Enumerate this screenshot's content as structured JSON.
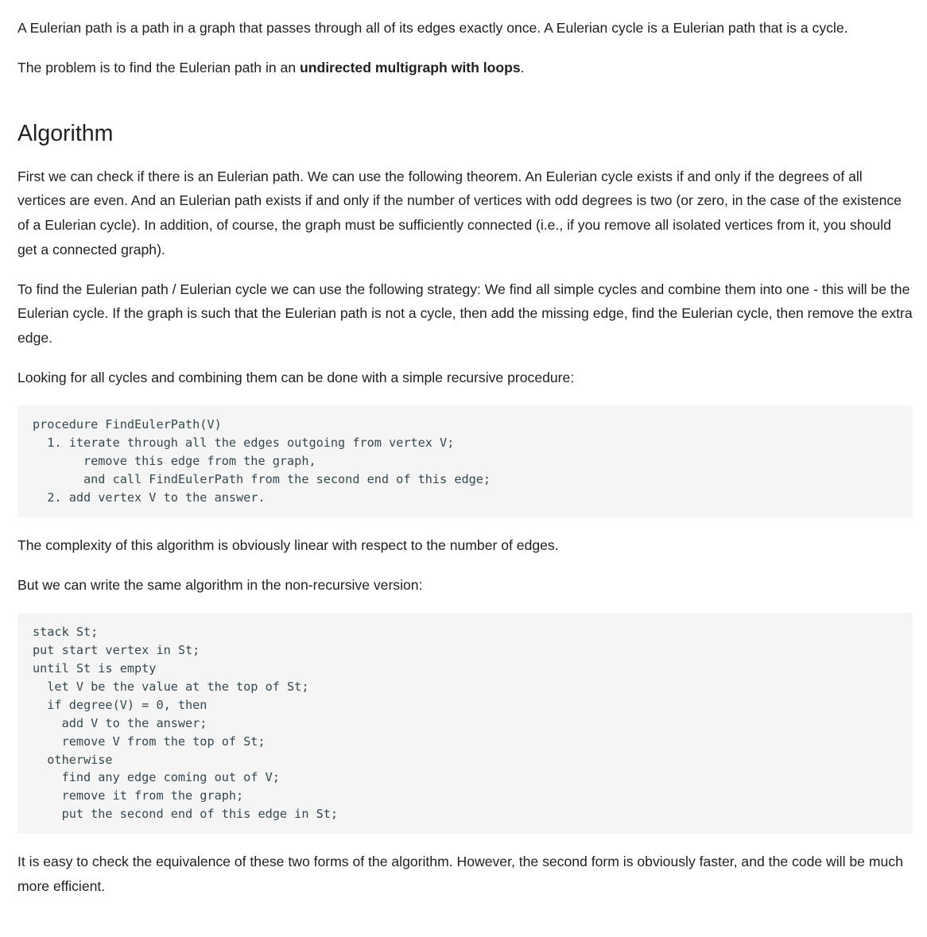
{
  "intro": {
    "p1": "A Eulerian path is a path in a graph that passes through all of its edges exactly once. A Eulerian cycle is a Eulerian path that is a cycle.",
    "p2_before": "The problem is to find the Eulerian path in an ",
    "p2_bold": "undirected multigraph with loops",
    "p2_after": "."
  },
  "algorithm": {
    "heading": "Algorithm",
    "p1": "First we can check if there is an Eulerian path. We can use the following theorem. An Eulerian cycle exists if and only if the degrees of all vertices are even. And an Eulerian path exists if and only if the number of vertices with odd degrees is two (or zero, in the case of the existence of a Eulerian cycle). In addition, of course, the graph must be sufficiently connected (i.e., if you remove all isolated vertices from it, you should get a connected graph).",
    "p2": "To find the Eulerian path / Eulerian cycle we can use the following strategy: We find all simple cycles and combine them into one - this will be the Eulerian cycle. If the graph is such that the Eulerian path is not a cycle, then add the missing edge, find the Eulerian cycle, then remove the extra edge.",
    "p3": "Looking for all cycles and combining them can be done with a simple recursive procedure:",
    "code1": "procedure FindEulerPath(V)\n  1. iterate through all the edges outgoing from vertex V;\n       remove this edge from the graph,\n       and call FindEulerPath from the second end of this edge;\n  2. add vertex V to the answer.",
    "p4": "The complexity of this algorithm is obviously linear with respect to the number of edges.",
    "p5": "But we can write the same algorithm in the non-recursive version:",
    "code2": "stack St;\nput start vertex in St;\nuntil St is empty\n  let V be the value at the top of St;\n  if degree(V) = 0, then\n    add V to the answer;\n    remove V from the top of St;\n  otherwise\n    find any edge coming out of V;\n    remove it from the graph;\n    put the second end of this edge in St;",
    "p6": "It is easy to check the equivalence of these two forms of the algorithm. However, the second form is obviously faster, and the code will be much more efficient."
  }
}
